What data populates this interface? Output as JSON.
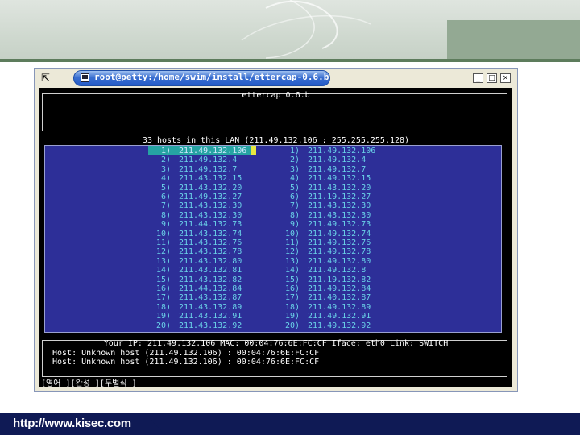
{
  "footer": {
    "url": "http://www.kisec.com"
  },
  "window": {
    "title": "root@petty:/home/swim/install/ettercap-0.6.b",
    "buttons": {
      "minimize": "_",
      "maximize": "□",
      "close": "×"
    }
  },
  "terminal": {
    "app_title": "ettercap 0.6.b",
    "hosts_header": "33 hosts in this LAN (211.49.132.106 : 255.255.255.128)",
    "left_hosts": [
      {
        "num": "1)",
        "ip": "211.49.132.106"
      },
      {
        "num": "2)",
        "ip": "211.49.132.4"
      },
      {
        "num": "3)",
        "ip": "211.49.132.7"
      },
      {
        "num": "4)",
        "ip": "211.43.132.15"
      },
      {
        "num": "5)",
        "ip": "211.43.132.20"
      },
      {
        "num": "6)",
        "ip": "211.49.132.27"
      },
      {
        "num": "7)",
        "ip": "211.43.132.30"
      },
      {
        "num": "8)",
        "ip": "211.43.132.30"
      },
      {
        "num": "9)",
        "ip": "211.44.132.73"
      },
      {
        "num": "10)",
        "ip": "211.43.132.74"
      },
      {
        "num": "11)",
        "ip": "211.43.132.76"
      },
      {
        "num": "12)",
        "ip": "211.43.132.78"
      },
      {
        "num": "13)",
        "ip": "211.43.132.80"
      },
      {
        "num": "14)",
        "ip": "211.43.132.81"
      },
      {
        "num": "15)",
        "ip": "211.43.132.82"
      },
      {
        "num": "16)",
        "ip": "211.44.132.84"
      },
      {
        "num": "17)",
        "ip": "211.43.132.87"
      },
      {
        "num": "18)",
        "ip": "211.43.132.89"
      },
      {
        "num": "19)",
        "ip": "211.43.132.91"
      },
      {
        "num": "20)",
        "ip": "211.43.132.92"
      }
    ],
    "right_hosts": [
      {
        "num": "1)",
        "ip": "211.49.132.106"
      },
      {
        "num": "2)",
        "ip": "211.49.132.4"
      },
      {
        "num": "3)",
        "ip": "211.49.132.7"
      },
      {
        "num": "4)",
        "ip": "211.49.132.15"
      },
      {
        "num": "5)",
        "ip": "211.43.132.20"
      },
      {
        "num": "6)",
        "ip": "211.19.132.27"
      },
      {
        "num": "7)",
        "ip": "211.43.132.30"
      },
      {
        "num": "8)",
        "ip": "211.43.132.30"
      },
      {
        "num": "9)",
        "ip": "211.49.132.73"
      },
      {
        "num": "10)",
        "ip": "211.49.132.74"
      },
      {
        "num": "11)",
        "ip": "211.49.132.76"
      },
      {
        "num": "12)",
        "ip": "211.49.132.78"
      },
      {
        "num": "13)",
        "ip": "211.49.132.80"
      },
      {
        "num": "14)",
        "ip": "211.49.132.8"
      },
      {
        "num": "15)",
        "ip": "211.19.132.82"
      },
      {
        "num": "16)",
        "ip": "211.49.132.84"
      },
      {
        "num": "17)",
        "ip": "211.40.132.87"
      },
      {
        "num": "18)",
        "ip": "211.49.132.89"
      },
      {
        "num": "19)",
        "ip": "211.49.132.91"
      },
      {
        "num": "20)",
        "ip": "211.49.132.92"
      }
    ],
    "your_ip_line": "Your IP: 211.49.132.106 MAC: 00:04:76:6E:FC:CF Iface: eth0 Link: SWITCH",
    "host_line_1": "Host: Unknown host (211.49.132.106) : 00:04:76:6E:FC:CF",
    "host_line_2": "Host: Unknown host (211.49.132.106) : 00:04:76:6E:FC:CF",
    "status_bar": "[영어 ][완성 ][두벌식 ]"
  }
}
